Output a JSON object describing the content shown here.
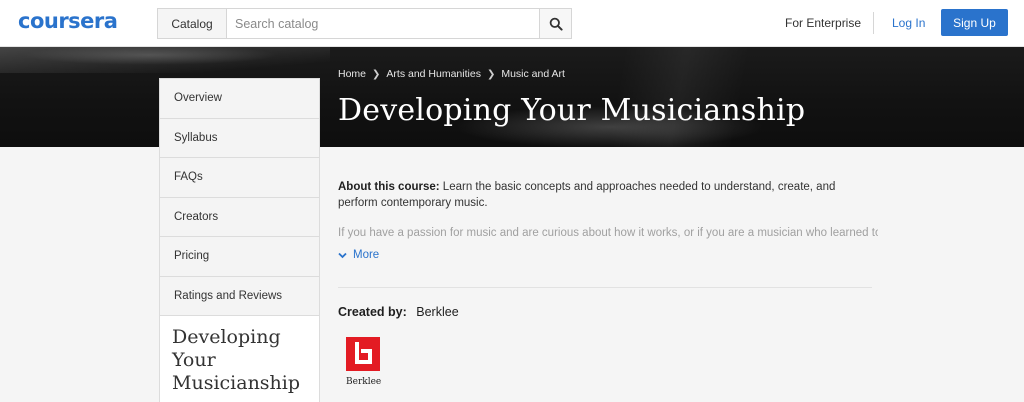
{
  "header": {
    "logo": "coursera",
    "catalog_label": "Catalog",
    "search_placeholder": "Search catalog",
    "enterprise_label": "For Enterprise",
    "login_label": "Log In",
    "signup_label": "Sign Up",
    "accent_color": "#2a73cc"
  },
  "breadcrumb": [
    "Home",
    "Arts and Humanities",
    "Music and Art"
  ],
  "course_title": "Developing Your Musicianship",
  "sidebar": {
    "items": [
      {
        "label": "Overview"
      },
      {
        "label": "Syllabus"
      },
      {
        "label": "FAQs"
      },
      {
        "label": "Creators"
      },
      {
        "label": "Pricing"
      },
      {
        "label": "Ratings and Reviews"
      }
    ],
    "title_lines": [
      "Developing",
      "Your",
      "Musicianship"
    ]
  },
  "about": {
    "label": "About this course:",
    "text": "Learn the basic concepts and approaches needed to understand, create, and perform contemporary music.",
    "faded_text": "If you have a passion for music and are curious about how it works, or if you are a musician who learned to",
    "more_label": "More"
  },
  "creator": {
    "label": "Created by:",
    "name": "Berklee",
    "logo_text": "Berklee",
    "logo_color": "#e31b23"
  },
  "icons": [
    "search-icon",
    "chevron-right-icon",
    "chevron-down-icon",
    "berklee-logo"
  ]
}
